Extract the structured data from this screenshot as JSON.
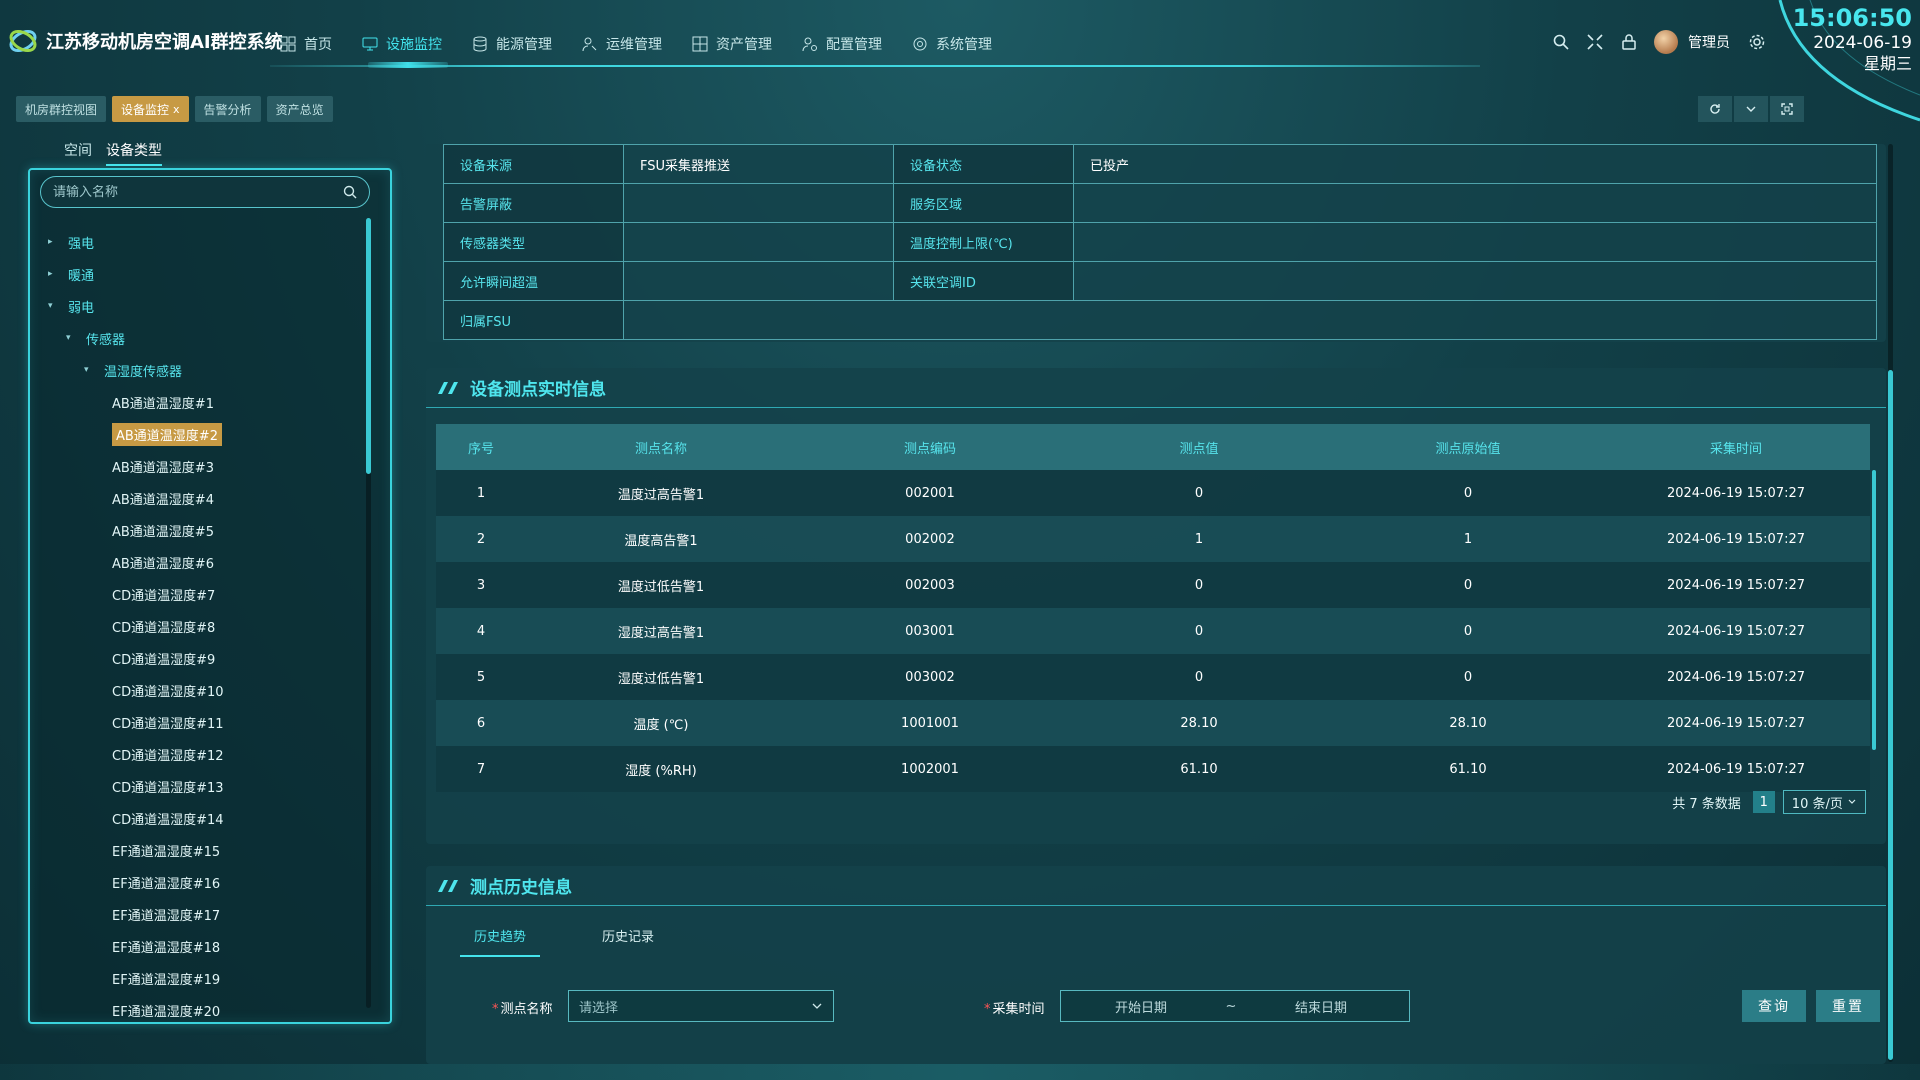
{
  "app": {
    "title": "江苏移动机房空调AI群控系统"
  },
  "nav": [
    {
      "label": "首页",
      "icon": "grid-icon",
      "active": false
    },
    {
      "label": "设施监控",
      "icon": "monitor-icon",
      "active": true
    },
    {
      "label": "能源管理",
      "icon": "database-icon",
      "active": false
    },
    {
      "label": "运维管理",
      "icon": "user-tool-icon",
      "active": false
    },
    {
      "label": "资产管理",
      "icon": "table-icon",
      "active": false
    },
    {
      "label": "配置管理",
      "icon": "user-gear-icon",
      "active": false
    },
    {
      "label": "系统管理",
      "icon": "circle-icon",
      "active": false
    }
  ],
  "user": {
    "name": "管理员"
  },
  "clock": {
    "time": "15:06:50",
    "date": "2024-06-19",
    "weekday": "星期三"
  },
  "page_tabs": [
    {
      "label": "机房群控视图",
      "active": false
    },
    {
      "label": "设备监控",
      "active": true,
      "close": "x"
    },
    {
      "label": "告警分析",
      "active": false
    },
    {
      "label": "资产总览",
      "active": false
    }
  ],
  "side": {
    "tabs": [
      "空间",
      "设备类型"
    ],
    "search_placeholder": "请输入名称",
    "tree": [
      {
        "label": "强电",
        "level": 0,
        "arrow": "▸"
      },
      {
        "label": "暖通",
        "level": 0,
        "arrow": "▸"
      },
      {
        "label": "弱电",
        "level": 0,
        "arrow": "▾"
      },
      {
        "label": "传感器",
        "level": 1,
        "arrow": "▾"
      },
      {
        "label": "温湿度传感器",
        "level": 2,
        "arrow": "▾"
      },
      {
        "label": "AB通道温湿度#1",
        "level": 3
      },
      {
        "label": "AB通道温湿度#2",
        "level": 3,
        "selected": true
      },
      {
        "label": "AB通道温湿度#3",
        "level": 3
      },
      {
        "label": "AB通道温湿度#4",
        "level": 3
      },
      {
        "label": "AB通道温湿度#5",
        "level": 3
      },
      {
        "label": "AB通道温湿度#6",
        "level": 3
      },
      {
        "label": "CD通道温湿度#7",
        "level": 3
      },
      {
        "label": "CD通道温湿度#8",
        "level": 3
      },
      {
        "label": "CD通道温湿度#9",
        "level": 3
      },
      {
        "label": "CD通道温湿度#10",
        "level": 3
      },
      {
        "label": "CD通道温湿度#11",
        "level": 3
      },
      {
        "label": "CD通道温湿度#12",
        "level": 3
      },
      {
        "label": "CD通道温湿度#13",
        "level": 3
      },
      {
        "label": "CD通道温湿度#14",
        "level": 3
      },
      {
        "label": "EF通道温湿度#15",
        "level": 3
      },
      {
        "label": "EF通道温湿度#16",
        "level": 3
      },
      {
        "label": "EF通道温湿度#17",
        "level": 3
      },
      {
        "label": "EF通道温湿度#18",
        "level": 3
      },
      {
        "label": "EF通道温湿度#19",
        "level": 3
      },
      {
        "label": "EF通道温湿度#20",
        "level": 3
      }
    ]
  },
  "info": {
    "rows": [
      [
        {
          "k": "设备来源",
          "v": "FSU采集器推送"
        },
        {
          "k": "设备状态",
          "v": "已投产"
        }
      ],
      [
        {
          "k": "告警屏蔽",
          "v": ""
        },
        {
          "k": "服务区域",
          "v": ""
        }
      ],
      [
        {
          "k": "传感器类型",
          "v": ""
        },
        {
          "k": "温度控制上限(℃)",
          "v": ""
        }
      ],
      [
        {
          "k": "允许瞬间超温",
          "v": ""
        },
        {
          "k": "关联空调ID",
          "v": ""
        }
      ],
      [
        {
          "k": "归属FSU",
          "v": ""
        }
      ]
    ]
  },
  "realtime": {
    "title": "设备测点实时信息",
    "columns": [
      "序号",
      "测点名称",
      "测点编码",
      "测点值",
      "测点原始值",
      "采集时间"
    ],
    "rows": [
      [
        "1",
        "温度过高告警1",
        "002001",
        "0",
        "0",
        "2024-06-19 15:07:27"
      ],
      [
        "2",
        "温度高告警1",
        "002002",
        "1",
        "1",
        "2024-06-19 15:07:27"
      ],
      [
        "3",
        "温度过低告警1",
        "002003",
        "0",
        "0",
        "2024-06-19 15:07:27"
      ],
      [
        "4",
        "湿度过高告警1",
        "003001",
        "0",
        "0",
        "2024-06-19 15:07:27"
      ],
      [
        "5",
        "湿度过低告警1",
        "003002",
        "0",
        "0",
        "2024-06-19 15:07:27"
      ],
      [
        "6",
        "温度 (℃)",
        "1001001",
        "28.10",
        "28.10",
        "2024-06-19 15:07:27"
      ],
      [
        "7",
        "湿度 (%RH)",
        "1002001",
        "61.10",
        "61.10",
        "2024-06-19 15:07:27"
      ]
    ],
    "total_text": "共 7 条数据",
    "page": "1",
    "page_size": "10 条/页"
  },
  "history": {
    "title": "测点历史信息",
    "tabs": [
      "历史趋势",
      "历史记录"
    ],
    "point_label": "测点名称",
    "point_placeholder": "请选择",
    "time_label": "采集时间",
    "start_placeholder": "开始日期",
    "separator": "~",
    "end_placeholder": "结束日期",
    "query_label": "查询",
    "reset_label": "重置"
  },
  "colors": {
    "accent": "#45e3ec",
    "selected": "#c79a44",
    "panel": "#14424a"
  }
}
